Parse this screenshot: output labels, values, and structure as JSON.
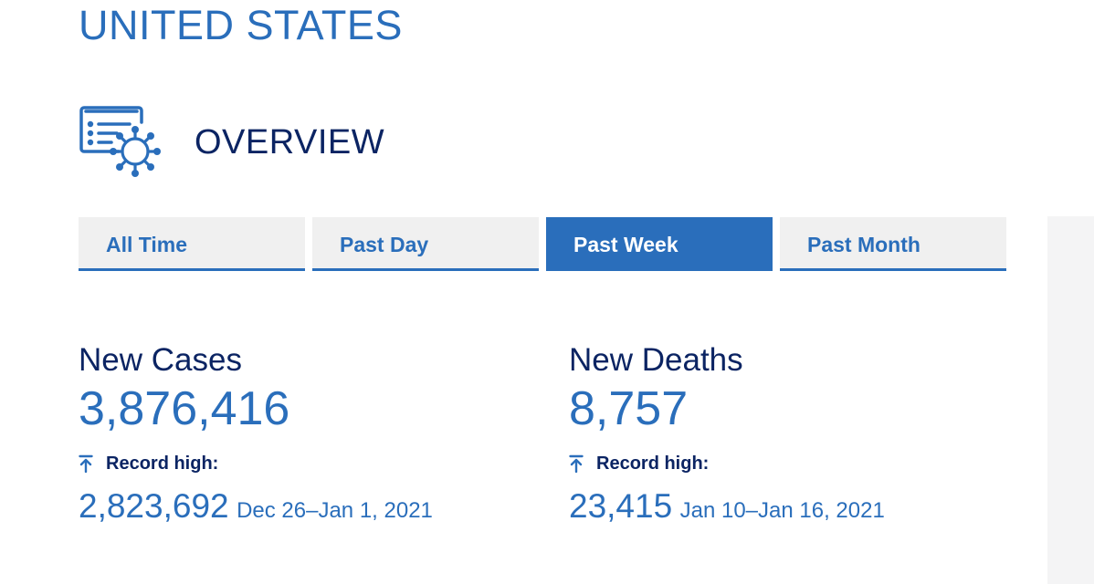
{
  "country": {
    "title": "UNITED STATES"
  },
  "overview": {
    "icon": "dashboard-virus-icon",
    "title": "OVERVIEW"
  },
  "tabs": [
    {
      "label": "All Time",
      "active": false
    },
    {
      "label": "Past Day",
      "active": false
    },
    {
      "label": "Past Week",
      "active": true
    },
    {
      "label": "Past Month",
      "active": false
    }
  ],
  "stats": {
    "new_cases": {
      "label": "New Cases",
      "value": "3,876,416",
      "record_icon": "arrow-up-to-bar-icon",
      "record_label": "Record high:",
      "record_value": "2,823,692",
      "record_date": "Dec 26–Jan 1, 2021"
    },
    "new_deaths": {
      "label": "New Deaths",
      "value": "8,757",
      "record_icon": "arrow-up-to-bar-icon",
      "record_label": "Record high:",
      "record_value": "23,415",
      "record_date": "Jan 10–Jan 16, 2021"
    }
  },
  "colors": {
    "accent": "#2a6ebb",
    "navy": "#0b2463",
    "tab_bg": "#f0f0f0",
    "side_panel": "#f4f4f5"
  }
}
